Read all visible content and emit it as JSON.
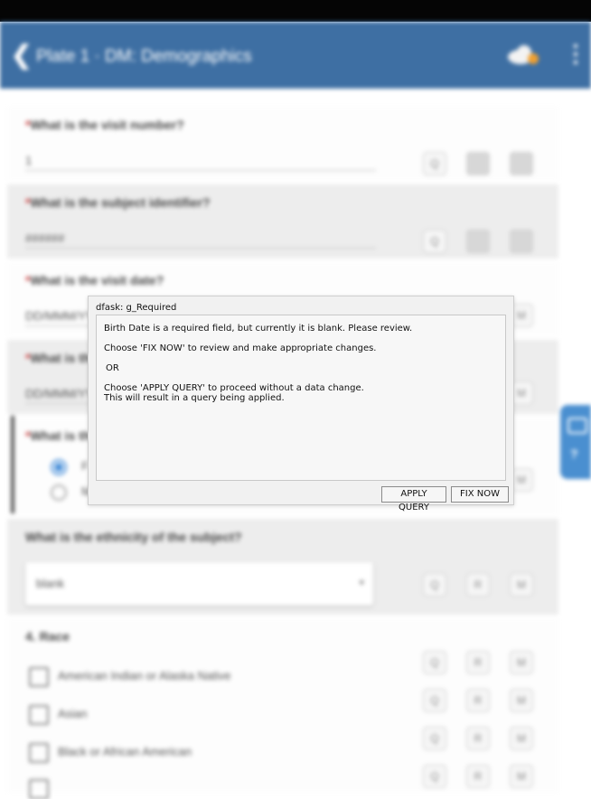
{
  "app_bar": {
    "back_glyph": "❮",
    "title": "Plate 1 · DM: Demographics",
    "more_glyph": "⋮"
  },
  "questions": {
    "visit_number": {
      "label": "What is the visit number?",
      "value": "1"
    },
    "subject_identifier": {
      "label": "What is the subject identifier?",
      "value": "######"
    },
    "visit_date": {
      "label": "What is the visit date?",
      "value": "DD/MMM/YYYY"
    },
    "birth_date": {
      "label": "What is the birth date?",
      "value": "DD/MMM/YYYY"
    },
    "sex": {
      "label": "What is the sex of the subject?",
      "options": [
        "F",
        "M"
      ]
    },
    "ethnicity": {
      "label": "What is the ethnicity of the subject?",
      "value": "blank"
    },
    "race": {
      "label": "4. Race",
      "options": [
        "American Indian or Alaska Native",
        "Asian",
        "Black or African American",
        ""
      ]
    }
  },
  "query_buttons": {
    "q": "Q",
    "r": "R",
    "m": "M"
  },
  "required_mark": "*",
  "dialog": {
    "title": "dfask: g_Required",
    "line1": "Birth Date is a required field, but currently it is blank. Please review.",
    "line2": "Choose 'FIX NOW' to review and make appropriate changes.",
    "line3": "OR",
    "line4": "Choose 'APPLY QUERY' to proceed without a data change.",
    "line5": "This will result in a query being applied.",
    "apply_query_label": "APPLY QUERY",
    "fix_now_label": "FIX NOW"
  },
  "colors": {
    "app_bar": "#3e6fa3",
    "accent": "#4a90d9"
  },
  "icons": {
    "cloud": "cloud-sync-icon",
    "side_tab": "help-icon"
  }
}
